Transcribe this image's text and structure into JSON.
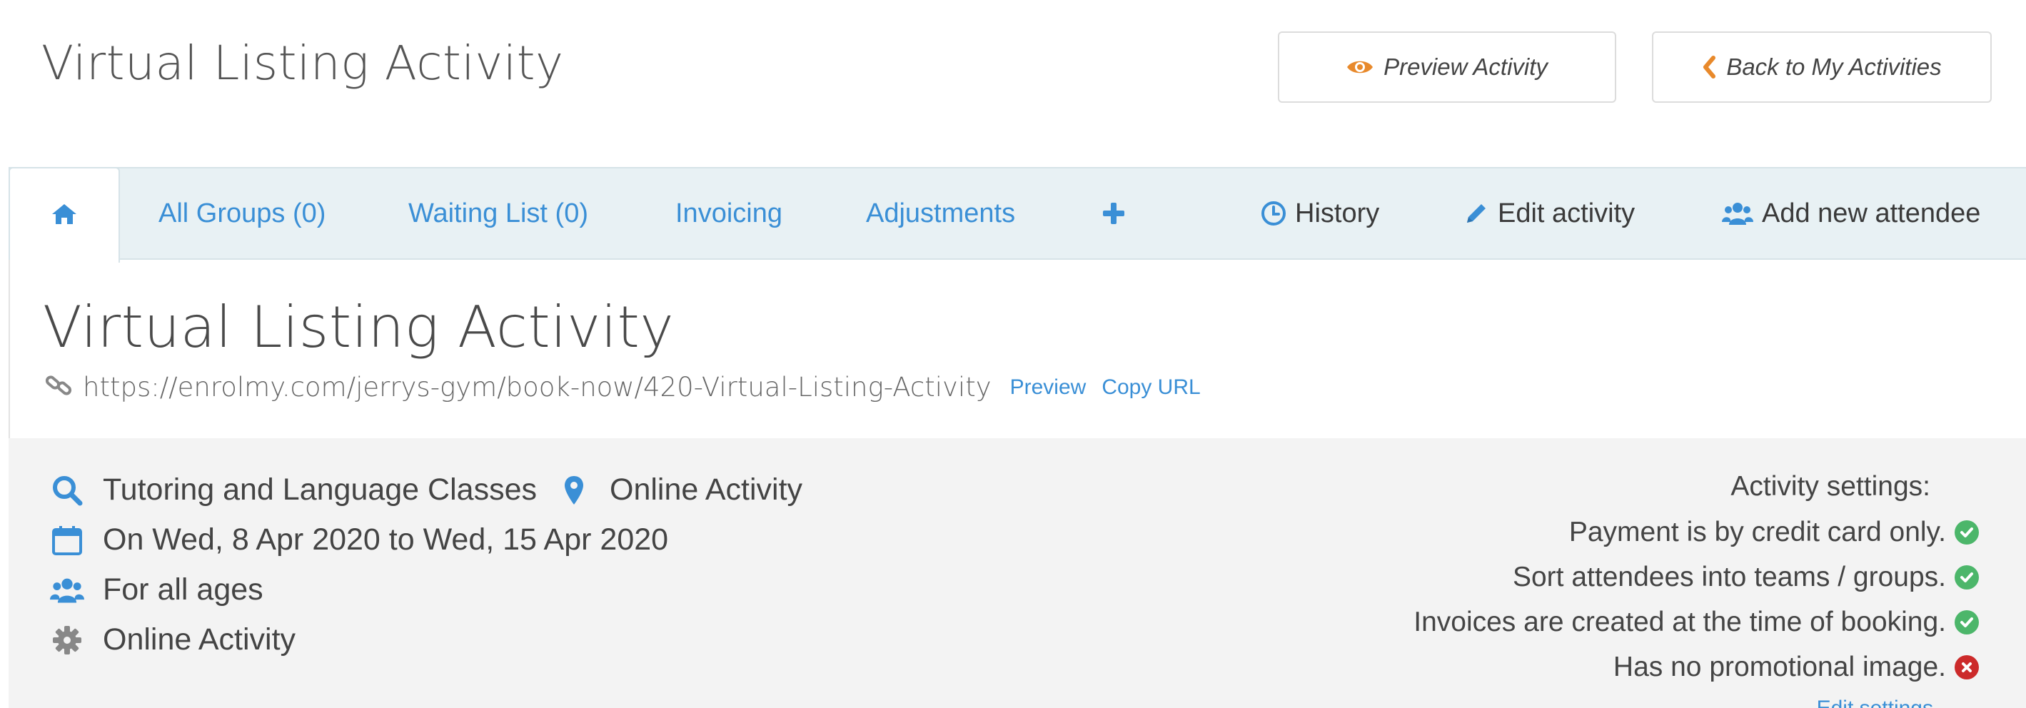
{
  "page_title": "Virtual Listing Activity",
  "header_buttons": {
    "preview": "Preview Activity",
    "back": "Back to My Activities"
  },
  "tabs": {
    "home_icon": "home-icon",
    "all_groups": "All Groups (0)",
    "waiting_list": "Waiting List (0)",
    "invoicing": "Invoicing",
    "adjustments": "Adjustments",
    "add_icon": "plus-icon",
    "history": "History",
    "edit_activity": "Edit activity",
    "add_attendee": "Add new attendee"
  },
  "activity": {
    "title": "Virtual Listing Activity",
    "url": "https://enrolmy.com/jerrys-gym/book-now/420-Virtual-Listing-Activity",
    "preview_link": "Preview",
    "copy_url_link": "Copy URL",
    "category": "Tutoring and Language Classes",
    "location": "Online Activity",
    "dates": "On Wed, 8 Apr 2020 to Wed, 15 Apr 2020",
    "ages": "For all ages",
    "type": "Online Activity"
  },
  "settings": {
    "title": "Activity settings:",
    "items": [
      {
        "text": "Payment is by credit card only.",
        "status": "enabled"
      },
      {
        "text": "Sort attendees into teams / groups.",
        "status": "enabled"
      },
      {
        "text": "Invoices are created at the time of booking.",
        "status": "enabled"
      },
      {
        "text": "Has no promotional image.",
        "status": "disabled"
      }
    ],
    "edit_link": "Edit settings"
  },
  "colors": {
    "link_blue": "#3a8fd6",
    "accent_orange": "#e8892b",
    "success_green": "#4cb66a",
    "error_red": "#cc2a2a",
    "tab_bar_bg": "#e8f1f4",
    "panel_bg": "#f3f3f3"
  }
}
